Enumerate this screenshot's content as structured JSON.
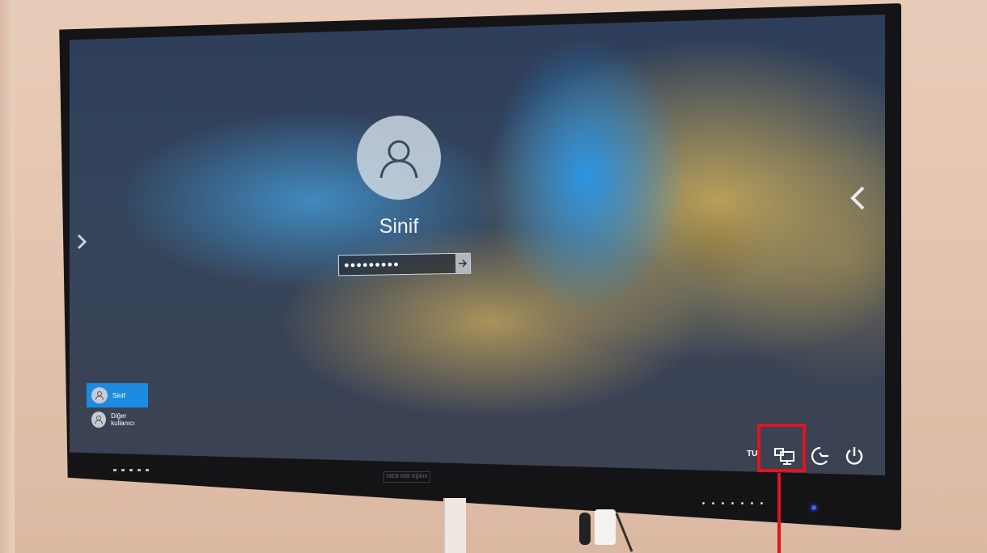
{
  "login": {
    "user_name": "Sinif",
    "password_mask": "●●●●●●●●●",
    "submit_icon": "arrow-right-icon"
  },
  "user_switcher": {
    "users": [
      {
        "name": "Sinif",
        "active": true
      },
      {
        "name": "Diğer kullanıcı",
        "active": false
      }
    ]
  },
  "system_tray": {
    "language": "TU",
    "icons": [
      "network-icon",
      "ease-of-access-icon",
      "power-icon"
    ]
  },
  "monitor": {
    "brand": "MEB Milli Eğitim"
  },
  "colors": {
    "accent": "#1d8be0",
    "highlight": "#e0141e"
  }
}
